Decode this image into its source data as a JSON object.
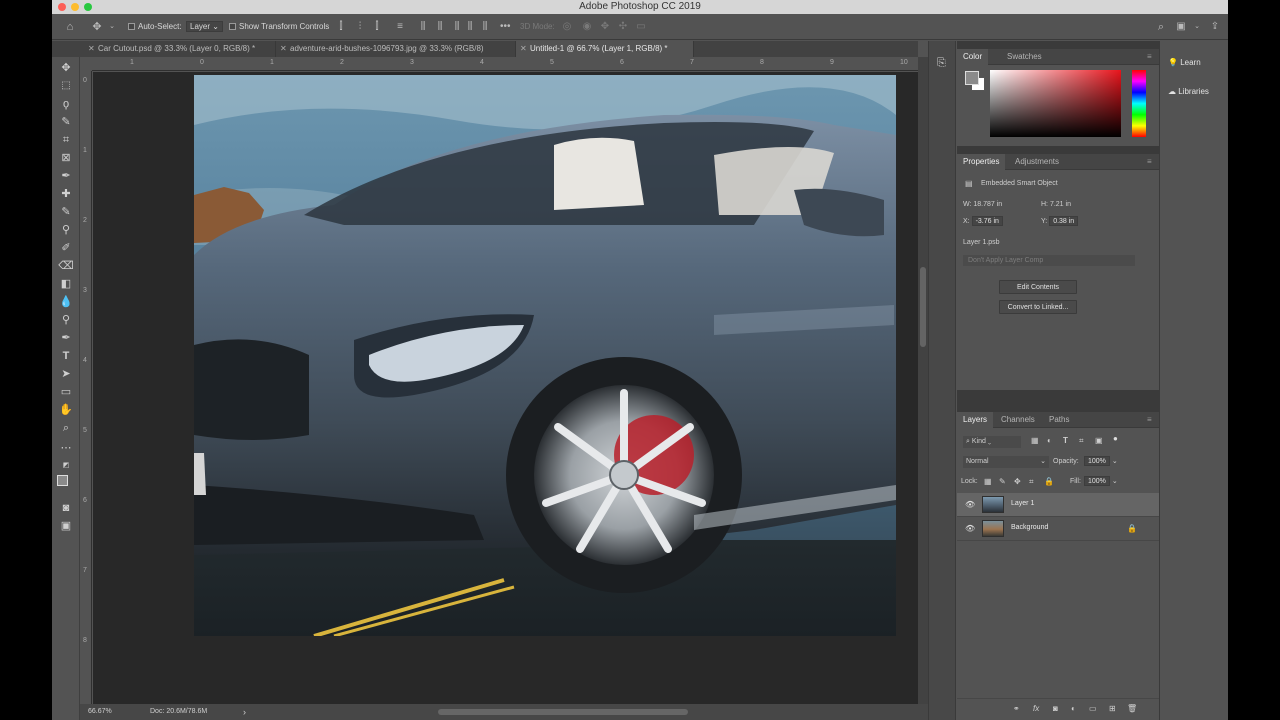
{
  "app": {
    "title": "Adobe Photoshop CC 2019"
  },
  "options_bar": {
    "auto_select_label": "Auto-Select:",
    "auto_select_target": "Layer",
    "show_transform_label": "Show Transform Controls",
    "mode_3d_label": "3D Mode:"
  },
  "tabs": [
    {
      "label": "Car Cutout.psd @ 33.3% (Layer 0, RGB/8) *"
    },
    {
      "label": "adventure-arid-bushes-1096793.jpg @ 33.3% (RGB/8)"
    },
    {
      "label": "Untitled-1 @ 66.7% (Layer 1, RGB/8) *"
    }
  ],
  "rulers": {
    "horizontal": [
      "1",
      "0",
      "1",
      "2",
      "3",
      "4",
      "5",
      "6",
      "7",
      "8",
      "9",
      "10"
    ],
    "vertical": [
      "0",
      "1",
      "2",
      "3",
      "4",
      "5",
      "6",
      "7",
      "8"
    ]
  },
  "status": {
    "zoom": "66.67%",
    "doc": "Doc: 20.6M/78.6M"
  },
  "color_panel": {
    "tabs": [
      "Color",
      "Swatches"
    ]
  },
  "properties_panel": {
    "tabs": [
      "Properties",
      "Adjustments"
    ],
    "type": "Embedded Smart Object",
    "w_label": "W:",
    "w_value": "18.787 in",
    "h_label": "H:",
    "h_value": "7.21 in",
    "x_label": "X:",
    "x_value": "-3.76 in",
    "y_label": "Y:",
    "y_value": "0.38 in",
    "file": "Layer 1.psb",
    "layer_comp": "Don't Apply Layer Comp",
    "edit_contents": "Edit Contents",
    "convert_linked": "Convert to Linked..."
  },
  "layers_panel": {
    "tabs": [
      "Layers",
      "Channels",
      "Paths"
    ],
    "filter_kind": "Kind",
    "blend_mode": "Normal",
    "opacity_label": "Opacity:",
    "opacity_value": "100%",
    "lock_label": "Lock:",
    "fill_label": "Fill:",
    "fill_value": "100%",
    "layers": [
      {
        "name": "Layer 1"
      },
      {
        "name": "Background"
      }
    ]
  },
  "right_dock": {
    "learn": "Learn",
    "libraries": "Libraries"
  },
  "colors": {
    "app_bg": "#535353",
    "canvas_bg": "#282828",
    "panel_bg": "#535353",
    "selection": "#656565"
  }
}
